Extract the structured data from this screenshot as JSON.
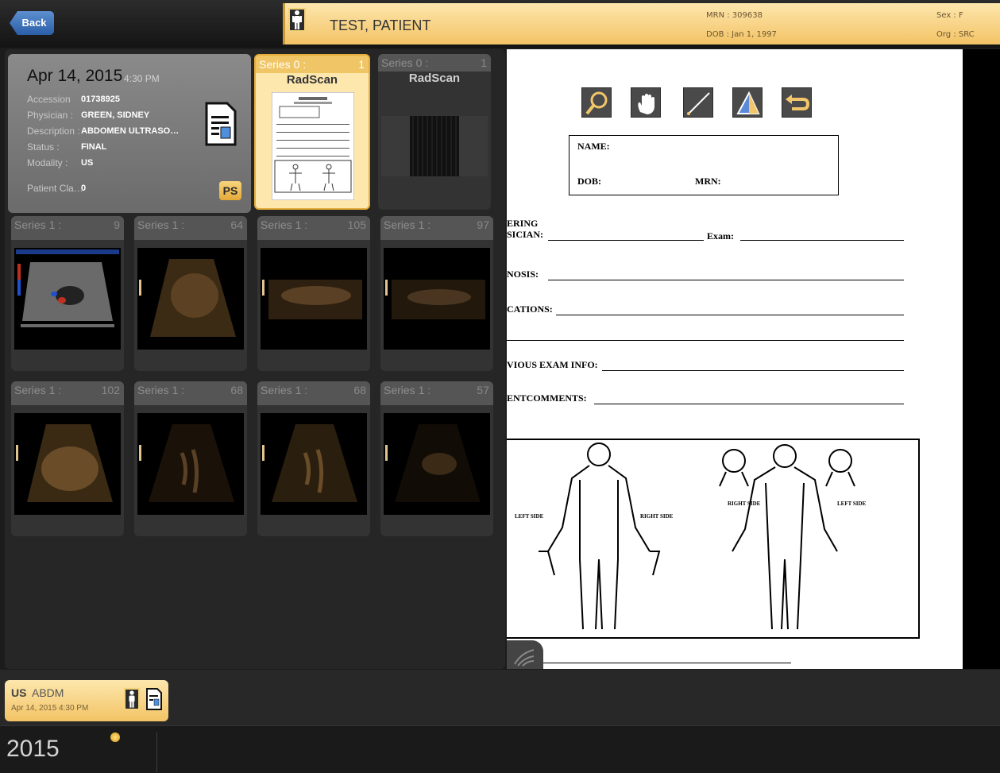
{
  "header": {
    "back_label": "Back",
    "patient_name": "TEST, PATIENT",
    "mrn": "MRN : 309638",
    "dob": "DOB : Jan 1, 1997",
    "sex": "Sex : F",
    "org": "Org : SRC"
  },
  "study": {
    "date": "Apr 14, 2015",
    "time": "4:30 PM",
    "fields": [
      {
        "label": "Accession",
        "value": "01738925"
      },
      {
        "label": "Physician :",
        "value": "GREEN, SIDNEY"
      },
      {
        "label": "Description :",
        "value": "ABDOMEN ULTRASO…"
      },
      {
        "label": "Status :",
        "value": "FINAL"
      },
      {
        "label": "Modality :",
        "value": "US"
      },
      {
        "label": "Patient Cla…",
        "value": "0"
      }
    ],
    "ps_badge": "PS"
  },
  "series": [
    {
      "title": "Series 0 :",
      "count": "1",
      "subtitle": "RadScan",
      "selected": true
    },
    {
      "title": "Series 0 :",
      "count": "1",
      "subtitle": "RadScan",
      "selected": false
    },
    {
      "title": "Series 1 :",
      "count": "9"
    },
    {
      "title": "Series 1 :",
      "count": "64"
    },
    {
      "title": "Series 1 :",
      "count": "105"
    },
    {
      "title": "Series 1 :",
      "count": "97"
    },
    {
      "title": "Series 1 :",
      "count": "102"
    },
    {
      "title": "Series 1 :",
      "count": "68"
    },
    {
      "title": "Series 1 :",
      "count": "68"
    },
    {
      "title": "Series 1 :",
      "count": "57"
    }
  ],
  "document": {
    "tools": [
      "zoom-icon",
      "pan-hand-icon",
      "measure-line-icon",
      "window-level-icon",
      "reset-icon"
    ],
    "name_label": "NAME:",
    "dob_label": "DOB:",
    "mrn_label": "MRN:",
    "ordering_line1": "ERING",
    "ordering_line2": "SICIAN:",
    "exam_label": "Exam:",
    "diagnosis_label": "NOSIS:",
    "indications_label": "CATIONS:",
    "previous_label": "VIOUS EXAM INFO:",
    "comments_label": "ENTCOMMENTS:",
    "left_side": "LEFT SIDE",
    "right_side": "RIGHT SIDE"
  },
  "study_tab": {
    "modality": "US",
    "description": "ABDM",
    "date": "Apr 14, 2015 4:30 PM"
  },
  "timeline": {
    "year": "2015"
  }
}
